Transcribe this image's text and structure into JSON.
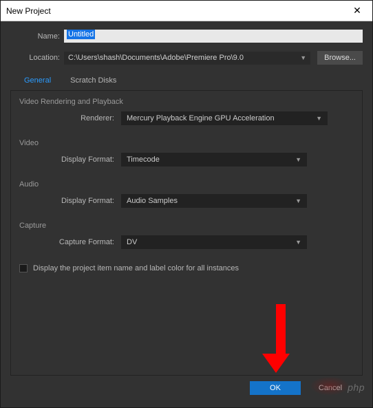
{
  "window": {
    "title": "New Project"
  },
  "fields": {
    "name_label": "Name:",
    "name_value": "Untitled",
    "location_label": "Location:",
    "location_value": "C:\\Users\\shash\\Documents\\Adobe\\Premiere Pro\\9.0",
    "browse": "Browse..."
  },
  "tabs": {
    "general": "General",
    "scratch": "Scratch Disks"
  },
  "sections": {
    "render": {
      "title": "Video Rendering and Playback",
      "renderer_label": "Renderer:",
      "renderer_value": "Mercury Playback Engine GPU Acceleration"
    },
    "video": {
      "title": "Video",
      "format_label": "Display Format:",
      "format_value": "Timecode"
    },
    "audio": {
      "title": "Audio",
      "format_label": "Display Format:",
      "format_value": "Audio Samples"
    },
    "capture": {
      "title": "Capture",
      "format_label": "Capture Format:",
      "format_value": "DV"
    }
  },
  "checkbox": {
    "label": "Display the project item name and label color for all instances"
  },
  "buttons": {
    "ok": "OK",
    "cancel": "Cancel"
  },
  "watermark": "php"
}
